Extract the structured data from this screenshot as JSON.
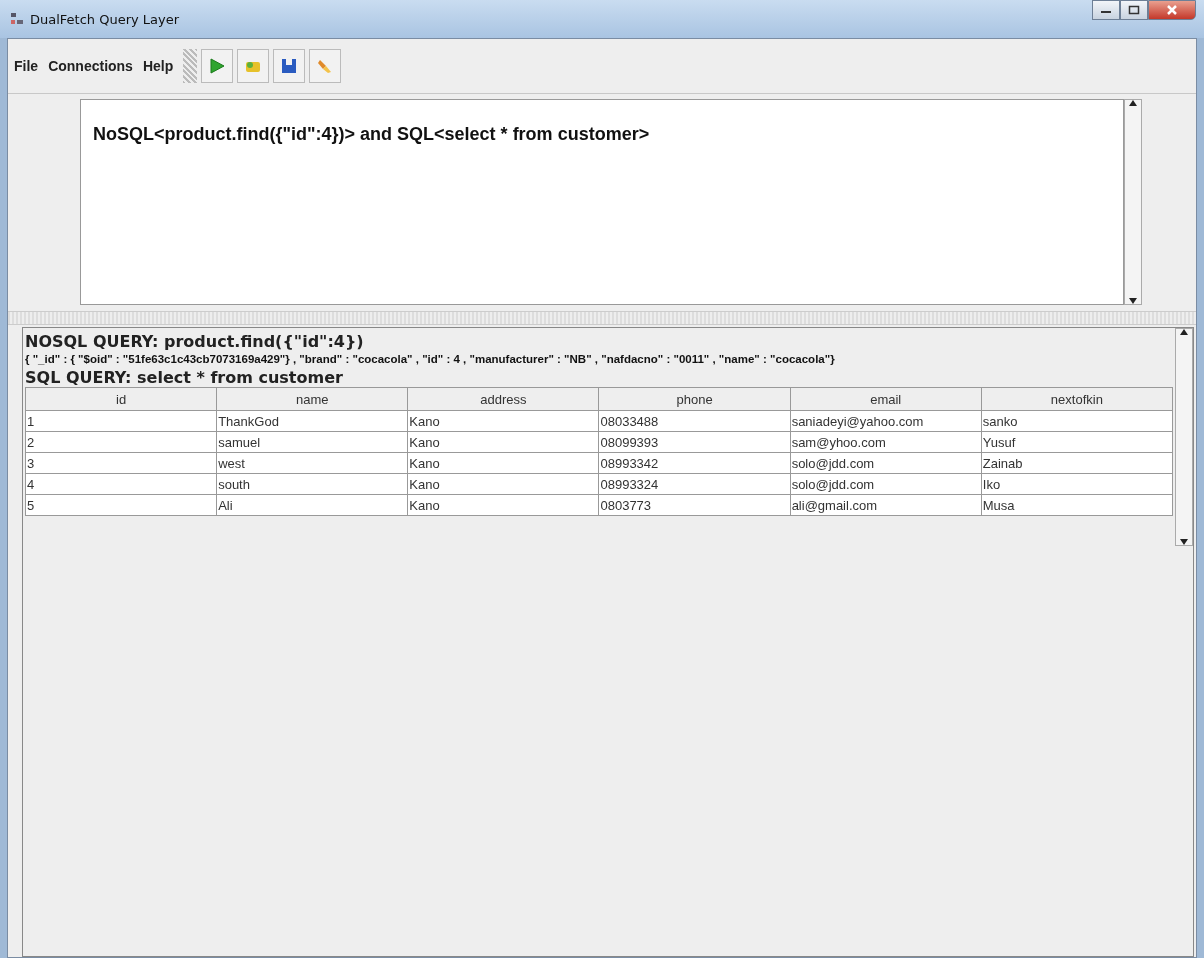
{
  "window": {
    "title": "DualFetch Query Layer"
  },
  "menu": [
    "File",
    "Connections",
    "Help"
  ],
  "query_editor": {
    "value": "NoSQL<product.find({\"id\":4})> and SQL<select * from customer>"
  },
  "results": {
    "nosql_heading": "NOSQL QUERY: product.find({\"id\":4})",
    "nosql_result": "{ \"_id\" : { \"$oid\" : \"51fe63c1c43cb7073169a429\"} , \"brand\" : \"cocacola\" , \"id\" : 4 , \"manufacturer\" : \"NB\" , \"nafdacno\" : \"0011\" , \"name\" : \"cocacola\"}",
    "sql_heading": "SQL QUERY: select * from customer",
    "table": {
      "columns": [
        "id",
        "name",
        "address",
        "phone",
        "email",
        "nextofkin"
      ],
      "rows": [
        [
          "1",
          "ThankGod",
          "Kano",
          "08033488",
          "saniadeyi@yahoo.com",
          "sanko"
        ],
        [
          "2",
          "samuel",
          "Kano",
          "08099393",
          "sam@yhoo.com",
          "Yusuf"
        ],
        [
          "3",
          "west",
          "Kano",
          "08993342",
          "solo@jdd.com",
          "Zainab"
        ],
        [
          "4",
          "south",
          "Kano",
          "08993324",
          "solo@jdd.com",
          "Iko"
        ],
        [
          "5",
          "Ali",
          "Kano",
          "0803773",
          "ali@gmail.com",
          "Musa"
        ]
      ]
    }
  }
}
